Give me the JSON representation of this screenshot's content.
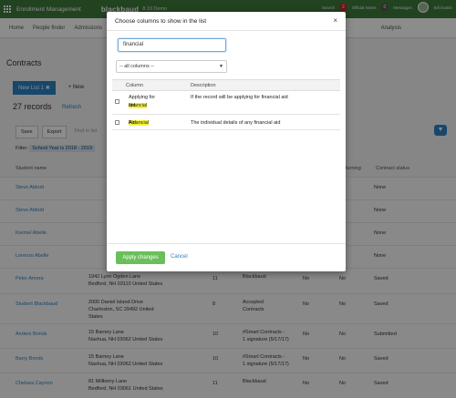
{
  "topbar": {
    "app_title": "Enrollment Management",
    "logo": "blackbaud",
    "demo": "8.10 Demo",
    "search": "Search",
    "notif_count": "2",
    "notif_label": "Official Notes",
    "msg_count": "0",
    "msg_label": "Messages",
    "user": "Bill Gustin"
  },
  "nav": {
    "items": [
      "Home",
      "People finder",
      "Admissions",
      "Analysis"
    ]
  },
  "page": {
    "title": "Contracts",
    "tab_active": "New List 1",
    "tab_new": "New",
    "records": "27 records",
    "refresh": "Refresh",
    "save": "Save",
    "export": "Export",
    "find": "Find in list",
    "filter_label": "Filter:",
    "filter_value": "School Year is 2018 - 2019"
  },
  "columns": {
    "student": "Student name",
    "returning": "Returning",
    "status": "Contract status"
  },
  "rows": [
    {
      "name": "Steve Abbott",
      "addr1": "",
      "addr2": "",
      "n": "",
      "type": "",
      "a": "",
      "b": "",
      "status": "None"
    },
    {
      "name": "Steve Abbott",
      "addr1": "",
      "addr2": "",
      "n": "",
      "type": "",
      "a": "",
      "b": "",
      "status": "None"
    },
    {
      "name": "Karmel Abelle",
      "addr1": "",
      "addr2": "",
      "n": "",
      "type": "",
      "a": "",
      "b": "",
      "status": "None"
    },
    {
      "name": "Lorenzo Abelle",
      "addr1": "",
      "addr2": "",
      "n": "",
      "type": "",
      "a": "",
      "b": "",
      "status": "None"
    },
    {
      "name": "Peter Amora",
      "addr1": "1942 Lynn Ogden Lane",
      "addr2": "Bedford, NH 03110 United States",
      "n": "11",
      "type": "Blackbaud",
      "a": "No",
      "b": "No",
      "status": "Saved"
    },
    {
      "name": "Student Blackbaud",
      "addr1": "2000 Daniel Island Drive",
      "addr2": "Charleston, SC 29492 United",
      "addr3": "States",
      "n": "8",
      "type": "Accepted",
      "type2": "Contracts",
      "a": "No",
      "b": "No",
      "status": "Saved"
    },
    {
      "name": "Anders Bonds",
      "addr1": "15 Barney Lane",
      "addr2": "Nashua, NH 03062 United States",
      "n": "10",
      "type": "#Smart Contracts -",
      "type2": "1 signature (5/17/17)",
      "a": "No",
      "b": "No",
      "status": "Submitted"
    },
    {
      "name": "Barry Bonds",
      "addr1": "15 Barney Lane",
      "addr2": "Nashua, NH 03062 United States",
      "n": "10",
      "type": "#Smart Contracts -",
      "type2": "1 signature (5/17/17)",
      "a": "No",
      "b": "No",
      "status": "Saved"
    },
    {
      "name": "Chelsea Caynon",
      "addr1": "81 Millberry Lane",
      "addr2": "Bedford, NH 03061 United States",
      "n": "11",
      "type": "Blackbaud",
      "a": "No",
      "b": "No",
      "status": "Saved"
    }
  ],
  "modal": {
    "title": "Choose columns to show in the list",
    "close": "×",
    "search_value": "financial",
    "select_value": "-- all columns --",
    "col_column": "Column",
    "col_description": "Description",
    "items": [
      {
        "label_pre": "Applying for",
        "label_hl": "financial",
        "label_post": " aid",
        "description": "If the record will be applying for financial aid"
      },
      {
        "label_pre": "",
        "label_hl": "Financial",
        "label_post": " Aid",
        "description": "The individual details of any financial aid"
      }
    ],
    "apply": "Apply changes",
    "cancel": "Cancel"
  },
  "colors": {
    "brand_green": "#3d7a3a",
    "accent_blue": "#2a82c4",
    "apply_green": "#6abf5a",
    "highlight": "#f7f23b"
  }
}
